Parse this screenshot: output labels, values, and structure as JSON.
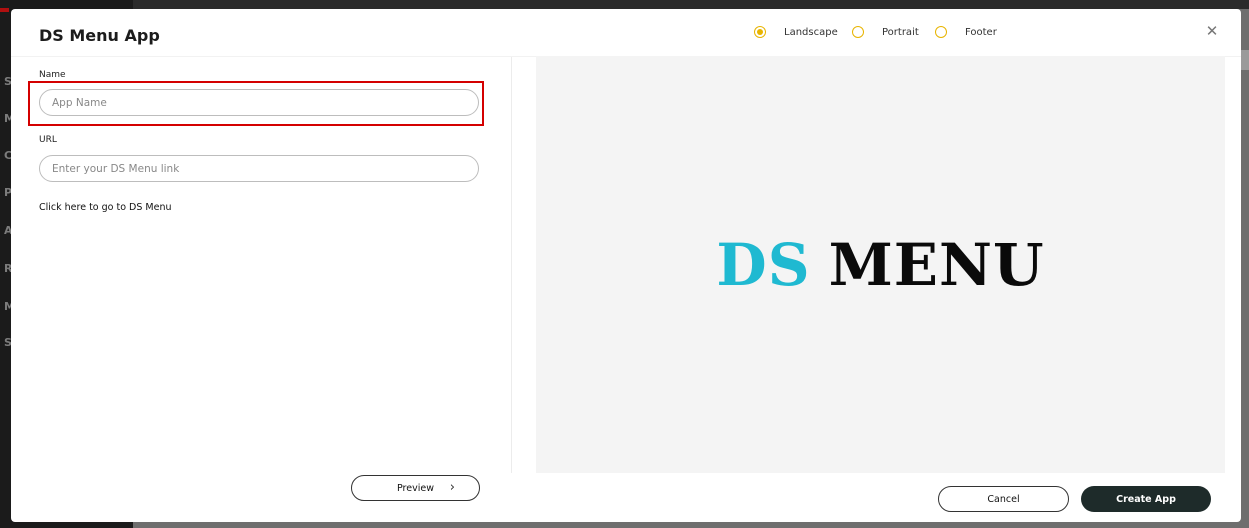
{
  "modal": {
    "title": "DS Menu App",
    "close_icon": "close-icon"
  },
  "orientation": {
    "options": [
      {
        "label": "Landscape",
        "checked": true
      },
      {
        "label": "Portrait",
        "checked": false
      },
      {
        "label": "Footer",
        "checked": false
      }
    ]
  },
  "form": {
    "name_label": "Name",
    "name_placeholder": "App Name",
    "name_value": "",
    "url_label": "URL",
    "url_placeholder": "Enter your DS Menu link",
    "url_value": "",
    "dsmenu_link": "Click here to go to DS Menu"
  },
  "preview": {
    "logo_part1": "DS",
    "logo_part2": "MENU",
    "logo_colors": {
      "ds": "#1fb9d1",
      "menu": "#0a0a0a"
    }
  },
  "buttons": {
    "preview_label": "Preview",
    "cancel_label": "Cancel",
    "create_label": "Create App"
  },
  "colors": {
    "accent_radio": "#e8b400",
    "primary_button": "#1e2b2a",
    "highlight": "#d40000"
  },
  "background": {
    "sidebar_letters": [
      "S",
      "M",
      "C",
      "P",
      "A",
      "R",
      "M",
      "S"
    ]
  }
}
